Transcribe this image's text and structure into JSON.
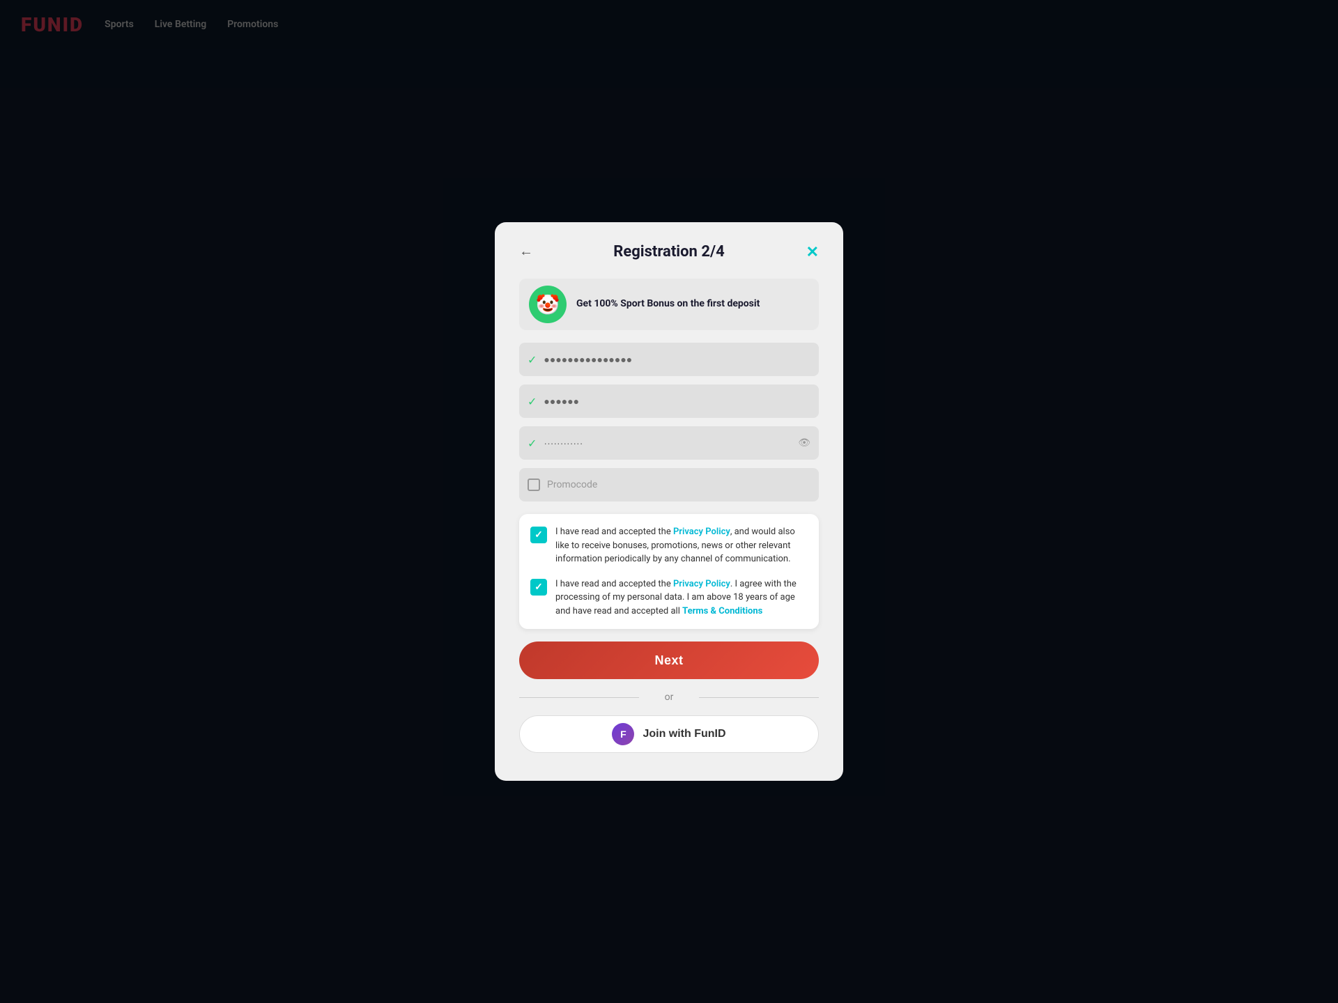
{
  "navbar": {
    "logo": "FUNID",
    "items": [
      "Sports",
      "Live Betting",
      "Promotions"
    ]
  },
  "modal": {
    "title": "Registration 2/4",
    "back_icon": "←",
    "close_icon": "✕",
    "bonus": {
      "icon": "🤡",
      "text": "Get 100% Sport Bonus on the\nfirst deposit"
    },
    "fields": {
      "email": {
        "value": "●●●●●●●●●●●●●●●",
        "completed": true
      },
      "username": {
        "value": "●●●●●●",
        "completed": true
      },
      "password": {
        "value": "············",
        "completed": true,
        "has_eye": true
      },
      "promo": {
        "placeholder": "Promocode"
      }
    },
    "consent1": {
      "checked": true,
      "text_before": "I have read and accepted the ",
      "link": "Privacy Policy",
      "text_after": ", and would also like to receive bonuses, promotions, news or other relevant information periodically by any channel of communication."
    },
    "consent2": {
      "checked": true,
      "text_before": "I have read and accepted the ",
      "link": "Privacy Policy",
      "text_mid": ". I agree with the processing of my personal data. I am above 18 years of age and have read and accepted all ",
      "link2": "Terms & Conditions",
      "text_after": ""
    },
    "next_button": "Next",
    "or_text": "or",
    "funid_button": "Join with FunID"
  }
}
